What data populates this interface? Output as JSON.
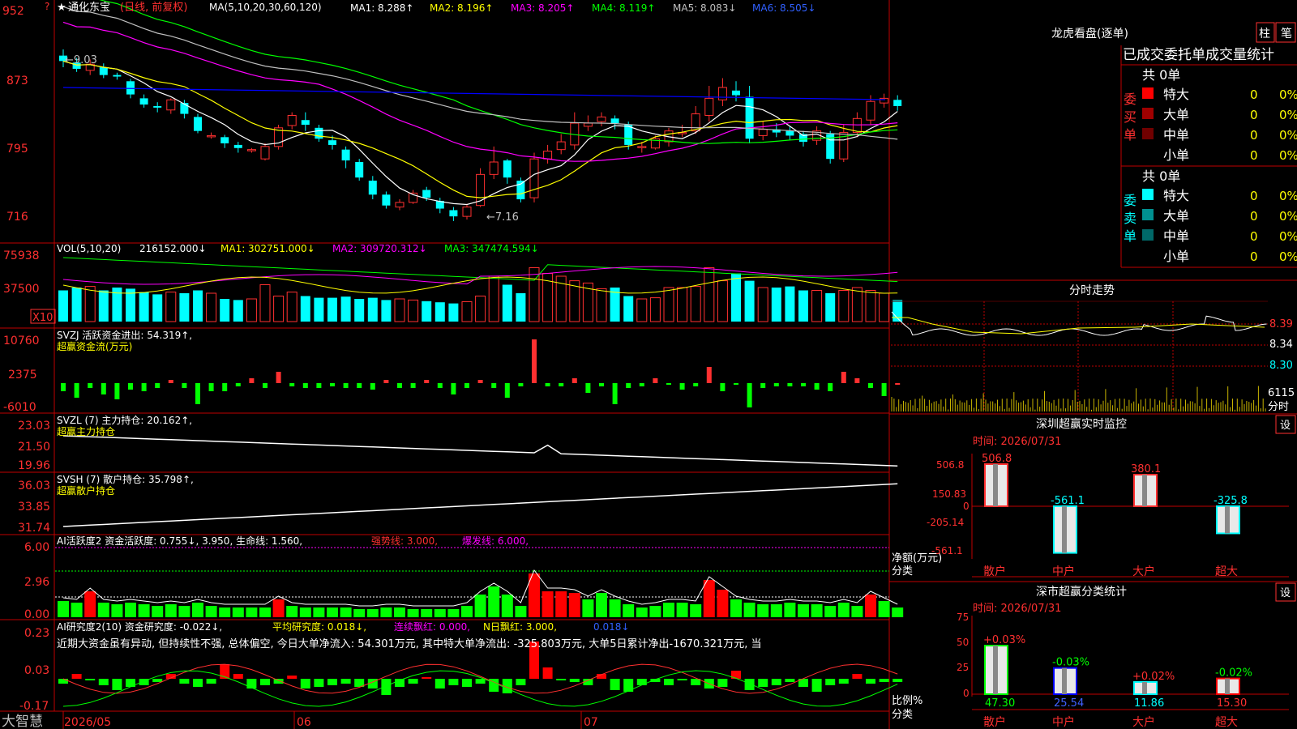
{
  "stock": {
    "name": "通化东宝",
    "mode": "(日线, 前复权)",
    "star": "★"
  },
  "ma_header": {
    "label": "MA(5,10,20,30,60,120)",
    "items": [
      {
        "text": "MA1: 8.288↑",
        "color": "#ffffff"
      },
      {
        "text": "MA2: 8.196↑",
        "color": "#ffff00"
      },
      {
        "text": "MA3: 8.205↑",
        "color": "#ff00ff"
      },
      {
        "text": "MA4: 8.119↑",
        "color": "#00ff00"
      },
      {
        "text": "MA5: 8.083↓",
        "color": "#c0c0c0"
      },
      {
        "text": "MA6: 8.505↓",
        "color": "#0000ff"
      }
    ]
  },
  "price_axis": [
    "952",
    "873",
    "795",
    "716"
  ],
  "price_annotations": {
    "high": "←9.03",
    "low": "←7.16"
  },
  "vol_header": {
    "label": "VOL(5,10,20)",
    "value": "216152.000↓",
    "items": [
      {
        "text": "MA1: 302751.000↓",
        "color": "#ffff00"
      },
      {
        "text": "MA2: 309720.312↓",
        "color": "#ff00ff"
      },
      {
        "text": "MA3: 347474.594↓",
        "color": "#00ff00"
      }
    ]
  },
  "vol_axis": [
    "75938",
    "37500"
  ],
  "vol_unit": "X10",
  "svzj": {
    "label": "SVZJ  活跃资金进出: 54.319↑,",
    "sub": "超赢资金流(万元)",
    "axis": [
      "10760",
      "2375",
      "-6010"
    ]
  },
  "svzl": {
    "label": "SVZL (7) 主力持仓: 20.162↑,",
    "sub": "超赢主力持仓",
    "axis": [
      "23.03",
      "21.50",
      "19.96"
    ]
  },
  "svsh": {
    "label": "SVSH (7) 散户持仓: 35.798↑,",
    "sub": "超赢散户持仓",
    "axis": [
      "36.03",
      "33.85",
      "31.74"
    ]
  },
  "ai1": {
    "label": "AI活跃度2 资金活跃度: 0.755↓, 3.950, 生命线: 1.560,",
    "strong": "强势线: 3.000,",
    "burst": "爆发线: 6.000,",
    "axis": [
      "6.00",
      "2.96",
      "0.00"
    ]
  },
  "ai2": {
    "label": "AI研究度2(10) 资金研究度: -0.022↓,",
    "avg": "平均研究度: 0.018↓,",
    "red": "连续飘红: 0.000,",
    "nred": "N日飘红: 3.000,",
    "last": "0.018↓",
    "axis": [
      "0.23",
      "0.03",
      "-0.17"
    ]
  },
  "summary_text": "近期大资金虽有异动, 但持续性不强, 总体偏空, 今日大单净流入: 54.301万元, 其中特大单净流出: -325.803万元, 大单5日累计净出-1670.321万元, 当",
  "date_axis": [
    "2026/05",
    "06",
    "07"
  ],
  "brand": "大智慧",
  "right": {
    "title": "龙虎看盘(逐单)",
    "btn1": "柱",
    "btn2": "笔",
    "stats_title": "已成交委托单成交量统计",
    "buy": {
      "label": "委买单",
      "total": "共 0单",
      "rows": [
        {
          "name": "特大",
          "value": "0",
          "pct": "0%",
          "color": "#ff0000"
        },
        {
          "name": "大单",
          "value": "0",
          "pct": "0%",
          "color": "#a00000"
        },
        {
          "name": "中单",
          "value": "0",
          "pct": "0%",
          "color": "#700000"
        },
        {
          "name": "小单",
          "value": "0",
          "pct": "0%",
          "color": ""
        }
      ]
    },
    "sell": {
      "label": "委卖单",
      "total": "共 0单",
      "rows": [
        {
          "name": "特大",
          "value": "0",
          "pct": "0%",
          "color": "#00ffff"
        },
        {
          "name": "大单",
          "value": "0",
          "pct": "0%",
          "color": "#009090"
        },
        {
          "name": "中单",
          "value": "0",
          "pct": "0%",
          "color": "#006868"
        },
        {
          "name": "小单",
          "value": "0",
          "pct": "0%",
          "color": ""
        }
      ]
    },
    "intraday": {
      "title": "分时走势",
      "axis": [
        "8.39",
        "8.34",
        "8.30",
        "6115",
        "分时"
      ]
    },
    "monitor": {
      "title": "深圳超赢实时监控",
      "time": "时间: 2026/07/31",
      "btn": "设",
      "axis": [
        "506.8",
        "150.83",
        "0",
        "-205.14",
        "-561.1"
      ],
      "unit1": "净额(万元)",
      "unit2": "分类",
      "bars": [
        {
          "cat": "散户",
          "value": 506.8,
          "label": "506.8"
        },
        {
          "cat": "中户",
          "value": -561.1,
          "label": "-561.1"
        },
        {
          "cat": "大户",
          "value": 380.1,
          "label": "380.1"
        },
        {
          "cat": "超大",
          "value": -325.8,
          "label": "-325.8"
        }
      ]
    },
    "classify": {
      "title": "深市超赢分类统计",
      "time": "时间: 2026/07/31",
      "btn": "设",
      "axis": [
        "75",
        "50",
        "25",
        "0"
      ],
      "unit1": "比例%",
      "unit2": "分类",
      "bars": [
        {
          "cat": "散户",
          "value": 47.3,
          "label": "47.30",
          "chg": "+0.03%",
          "chgcolor": "#ff3030",
          "color": "#00ff00"
        },
        {
          "cat": "中户",
          "value": 25.54,
          "label": "25.54",
          "chg": "-0.03%",
          "chgcolor": "#00ff00",
          "color": "#0000ff"
        },
        {
          "cat": "大户",
          "value": 11.86,
          "label": "11.86",
          "chg": "+0.02%",
          "chgcolor": "#ff3030",
          "color": "#00ffff"
        },
        {
          "cat": "超大",
          "value": 15.3,
          "label": "15.30",
          "chg": "-0.02%",
          "chgcolor": "#00ff00",
          "color": "#ff0000"
        }
      ]
    }
  },
  "chart_data": {
    "type": "candlestick",
    "title": "通化东宝 (日线, 前复权)",
    "x_labels": [
      "2026/05",
      "06",
      "07"
    ],
    "ylim": [
      7.16,
      9.52
    ],
    "candles": [
      [
        8.95,
        8.88,
        9.03,
        8.8
      ],
      [
        8.86,
        8.78,
        8.92,
        8.74
      ],
      [
        8.76,
        8.84,
        8.9,
        8.7
      ],
      [
        8.8,
        8.7,
        8.85,
        8.66
      ],
      [
        8.7,
        8.68,
        8.73,
        8.64
      ],
      [
        8.62,
        8.45,
        8.65,
        8.4
      ],
      [
        8.4,
        8.32,
        8.45,
        8.28
      ],
      [
        8.3,
        8.28,
        8.35,
        8.22
      ],
      [
        8.25,
        8.38,
        8.4,
        8.2
      ],
      [
        8.34,
        8.2,
        8.38,
        8.14
      ],
      [
        8.16,
        7.98,
        8.2,
        7.95
      ],
      [
        7.92,
        7.92,
        7.96,
        7.88
      ],
      [
        7.9,
        7.82,
        7.93,
        7.76
      ],
      [
        7.8,
        7.76,
        7.84,
        7.7
      ],
      [
        7.74,
        7.74,
        7.76,
        7.7
      ],
      [
        7.62,
        7.78,
        7.82,
        7.6
      ],
      [
        7.78,
        8.02,
        8.06,
        7.74
      ],
      [
        8.05,
        8.18,
        8.22,
        8.0
      ],
      [
        8.12,
        8.06,
        8.22,
        7.98
      ],
      [
        8.02,
        7.88,
        8.06,
        7.84
      ],
      [
        7.86,
        7.8,
        7.92,
        7.74
      ],
      [
        7.74,
        7.6,
        7.78,
        7.5
      ],
      [
        7.58,
        7.38,
        7.62,
        7.34
      ],
      [
        7.34,
        7.16,
        7.4,
        7.1
      ],
      [
        7.16,
        7.02,
        7.2,
        6.98
      ],
      [
        7.0,
        7.06,
        7.1,
        6.96
      ],
      [
        7.06,
        7.18,
        7.22,
        7.04
      ],
      [
        7.22,
        7.12,
        7.26,
        7.08
      ],
      [
        7.08,
        6.98,
        7.12,
        6.92
      ],
      [
        6.96,
        6.88,
        7.0,
        6.82
      ],
      [
        6.88,
        7.0,
        7.04,
        6.84
      ],
      [
        7.02,
        7.42,
        7.5,
        7.0
      ],
      [
        7.42,
        7.58,
        7.78,
        7.36
      ],
      [
        7.6,
        7.38,
        7.62,
        7.3
      ],
      [
        7.34,
        7.1,
        7.38,
        7.06
      ],
      [
        7.12,
        7.62,
        7.7,
        7.06
      ],
      [
        7.62,
        7.72,
        7.8,
        7.56
      ],
      [
        7.74,
        7.84,
        7.94,
        7.68
      ],
      [
        7.8,
        8.08,
        8.22,
        7.74
      ],
      [
        8.04,
        8.08,
        8.18,
        7.98
      ],
      [
        8.1,
        8.16,
        8.22,
        8.04
      ],
      [
        8.14,
        8.08,
        8.18,
        8.0
      ],
      [
        8.06,
        7.8,
        8.1,
        7.74
      ],
      [
        7.78,
        7.78,
        7.84,
        7.7
      ],
      [
        7.76,
        7.88,
        7.92,
        7.74
      ],
      [
        7.84,
        7.98,
        8.02,
        7.78
      ],
      [
        7.96,
        7.96,
        8.06,
        7.9
      ],
      [
        7.98,
        8.2,
        8.3,
        7.94
      ],
      [
        8.18,
        8.4,
        8.56,
        8.1
      ],
      [
        8.38,
        8.54,
        8.66,
        8.3
      ],
      [
        8.5,
        8.44,
        8.62,
        8.36
      ],
      [
        8.42,
        7.88,
        8.56,
        7.82
      ],
      [
        7.92,
        8.0,
        8.1,
        7.86
      ],
      [
        8.0,
        7.96,
        8.08,
        7.9
      ],
      [
        7.98,
        7.92,
        8.04,
        7.86
      ],
      [
        7.94,
        7.84,
        7.98,
        7.78
      ],
      [
        7.86,
        7.98,
        8.04,
        7.8
      ],
      [
        7.94,
        7.62,
        7.98,
        7.56
      ],
      [
        7.62,
        7.96,
        8.06,
        7.58
      ],
      [
        7.96,
        8.14,
        8.22,
        7.9
      ],
      [
        8.12,
        8.36,
        8.44,
        8.06
      ],
      [
        8.34,
        8.4,
        8.46,
        8.28
      ],
      [
        8.38,
        8.3,
        8.44,
        8.24
      ]
    ]
  }
}
